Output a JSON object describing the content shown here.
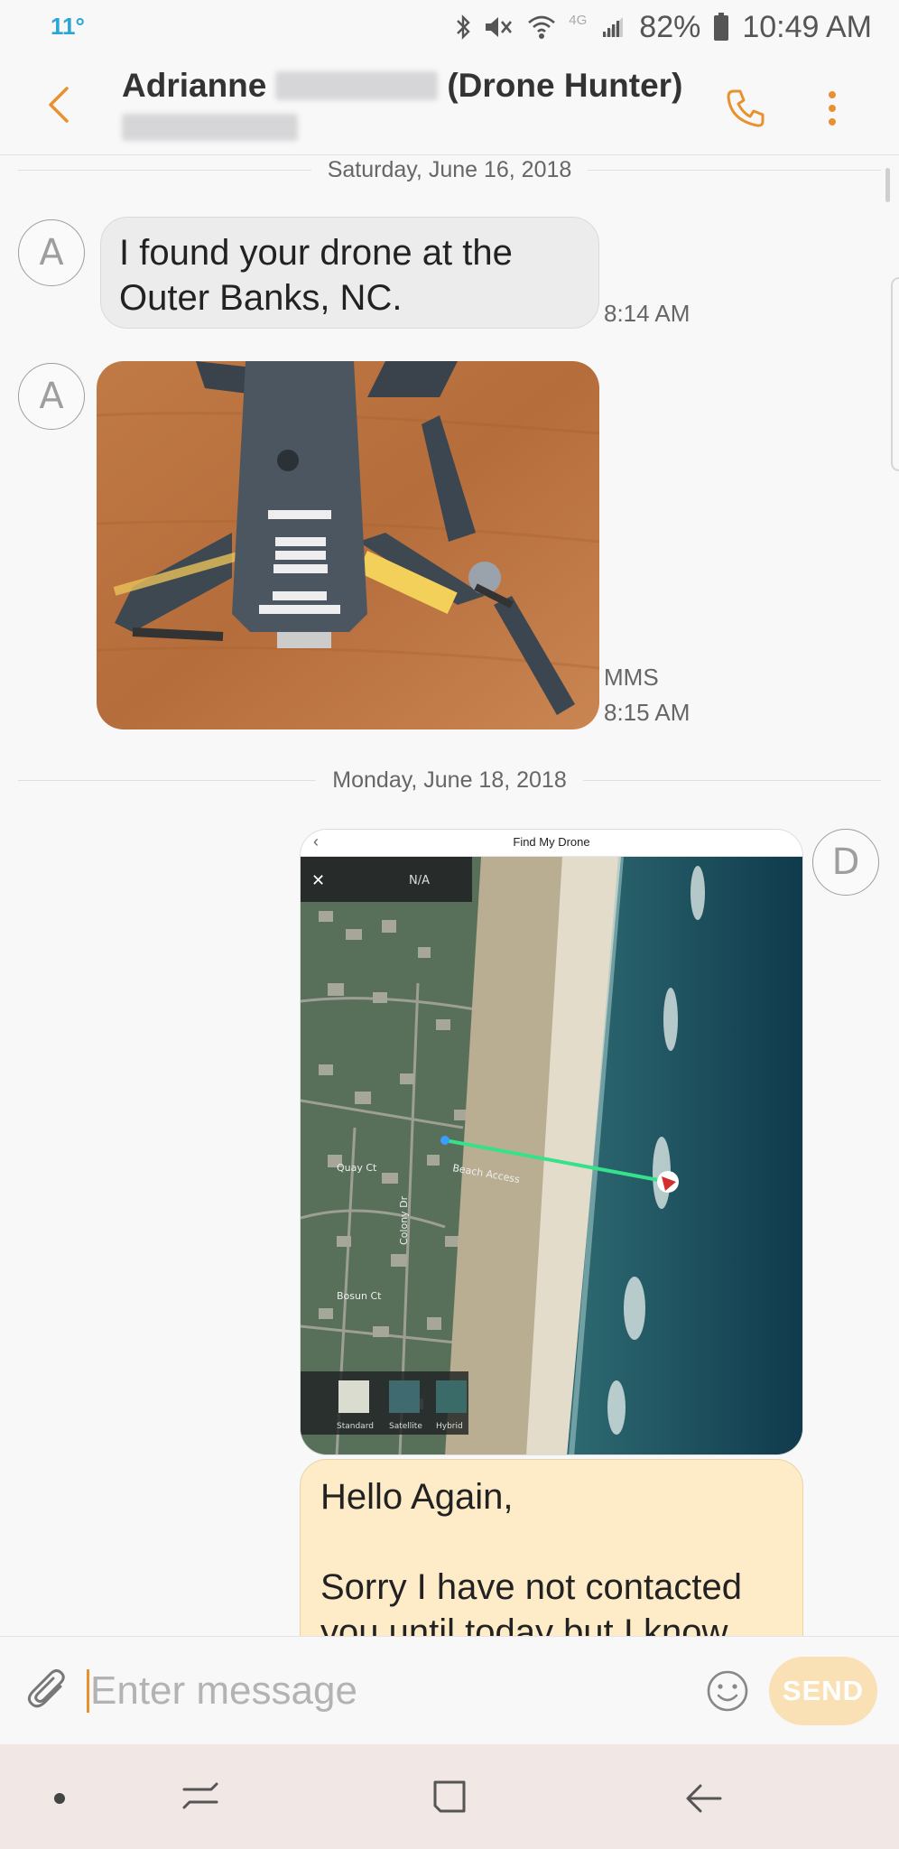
{
  "status_bar": {
    "temperature": "11°",
    "battery": "82%",
    "time": "10:49 AM",
    "network": "4G"
  },
  "header": {
    "name_first": "Adrianne",
    "name_suffix": "(Drone Hunter)"
  },
  "conversation": {
    "date_1": "Saturday, June 16, 2018",
    "date_2": "Monday, June 18, 2018",
    "msg_1": {
      "avatar": "A",
      "line1": "I found your drone at the",
      "line2": "Outer Banks, NC.",
      "time": "8:14 AM"
    },
    "msg_2": {
      "avatar": "A",
      "type_label": "MMS",
      "time": "8:15 AM"
    },
    "msg_3": {
      "avatar": "D",
      "screenshot_title": "Find My Drone",
      "map_labels": {
        "na": "N/A",
        "beach_access": "Beach Access",
        "quay": "Quay Ct",
        "bosun": "Bosun Ct",
        "colony": "Colony Dr",
        "standard": "Standard",
        "satellite": "Satellite",
        "hybrid": "Hybrid"
      }
    },
    "msg_4": {
      "line1": "Hello Again,",
      "line2": "Sorry I have not contacted",
      "line3": "you until today but I know"
    }
  },
  "composer": {
    "placeholder": "Enter message",
    "send_label": "SEND"
  },
  "colors": {
    "accent": "#e8922f",
    "incoming_bubble": "#ececec",
    "outgoing_bubble": "#fdecc7",
    "nav_bar": "#f1e7e4"
  },
  "icons": [
    "bluetooth-icon",
    "mute-icon",
    "wifi-icon",
    "signal-icon",
    "battery-icon",
    "back-arrow-icon",
    "phone-icon",
    "more-vertical-icon",
    "paperclip-icon",
    "emoji-icon",
    "nav-dot-icon",
    "nav-recents-icon",
    "nav-home-icon",
    "nav-back-icon"
  ]
}
